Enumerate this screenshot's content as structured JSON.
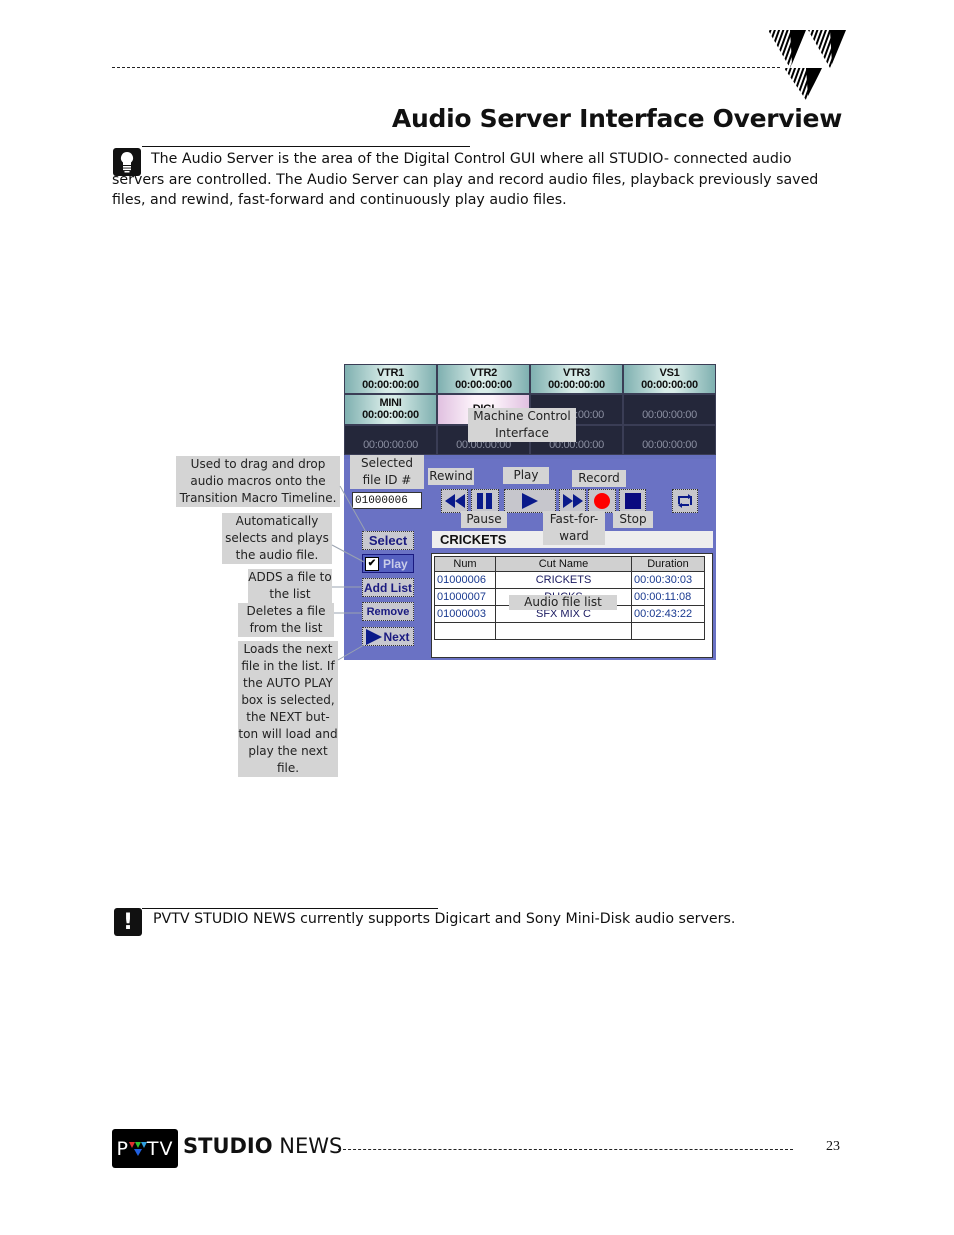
{
  "header": {
    "title": "Audio Server Interface Overview"
  },
  "intro_note": {
    "icon": "lightbulb-icon",
    "text": "The Audio Server is the area of the Digital Control GUI where all STUDIO- connected audio servers are controlled.  The Audio Server can play and record audio files, playback previously saved files, and rewind, fast-forward and continuously play audio files."
  },
  "gui": {
    "machines": [
      {
        "name": "VTR1",
        "timecode": "00:00:00:00",
        "state": "active"
      },
      {
        "name": "VTR2",
        "timecode": "00:00:00:00",
        "state": "active"
      },
      {
        "name": "VTR3",
        "timecode": "00:00:00:00",
        "state": "active"
      },
      {
        "name": "VS1",
        "timecode": "00:00:00:00",
        "state": "active"
      },
      {
        "name": "MINI",
        "timecode": "00:00:00:00",
        "state": "active"
      },
      {
        "name": "DIGI",
        "timecode": "",
        "state": "selected"
      },
      {
        "name": "",
        "timecode": "00:00:00:00",
        "state": "empty"
      },
      {
        "name": "",
        "timecode": "00:00:00:00",
        "state": "empty"
      },
      {
        "name": "",
        "timecode": "00:00:00:00",
        "state": "empty"
      },
      {
        "name": "",
        "timecode": "00:00:00:00",
        "state": "empty"
      },
      {
        "name": "",
        "timecode": "00:00:00:00",
        "state": "empty"
      },
      {
        "name": "",
        "timecode": "00:00:00:00",
        "state": "empty"
      }
    ],
    "selected_id": "01000006",
    "current_cut": "CRICKETS",
    "side_buttons": {
      "select": "Select",
      "auto_play": "Play",
      "auto_play_checked": true,
      "add_list": "Add List",
      "remove": "Remove",
      "next": "Next"
    },
    "transport": [
      "rewind",
      "pause",
      "play",
      "fast-forward",
      "record",
      "stop",
      "loop"
    ],
    "colors": {
      "record": "#ff0000",
      "transport_glyph": "#0a1a8a",
      "panel": "#6a72c4"
    },
    "list": {
      "columns": [
        "Num",
        "Cut Name",
        "Duration"
      ],
      "rows": [
        [
          "01000006",
          "CRICKETS",
          "00:00:30:03"
        ],
        [
          "01000007",
          "DUCKS",
          "00:00:11:08"
        ],
        [
          "01000003",
          "SFX MIX C",
          "00:02:43:22"
        ],
        [
          "",
          "",
          ""
        ]
      ]
    }
  },
  "callouts": {
    "machine_control": "Machine Control Interface",
    "selected_file": "Selected file ID #",
    "rewind": "Rewind",
    "play": "Play",
    "record": "Record",
    "pause": "Pause",
    "fast_forward": "Fast-for- ward",
    "stop": "Stop",
    "audio_file_list": "Audio file list",
    "select_desc": "Used to drag and drop audio macros onto the Transition Macro Timeline.",
    "auto_play_desc": "Automatically selects and plays the audio file.",
    "add_list_desc": "ADDS a file to the list",
    "remove_desc": "Deletes a file from the list",
    "next_desc": "Loads the next file in the list.  If the AUTO PLAY box is selected, the NEXT but- ton will load and play the next file."
  },
  "warning_note": {
    "icon": "exclamation-icon",
    "text": "PVTV STUDIO NEWS currently supports Digicart and Sony Mini-Disk audio servers."
  },
  "footer": {
    "logo": "PVTV",
    "brand_bold": "STUDIO",
    "brand_light": "NEWS",
    "page_number": "23"
  }
}
